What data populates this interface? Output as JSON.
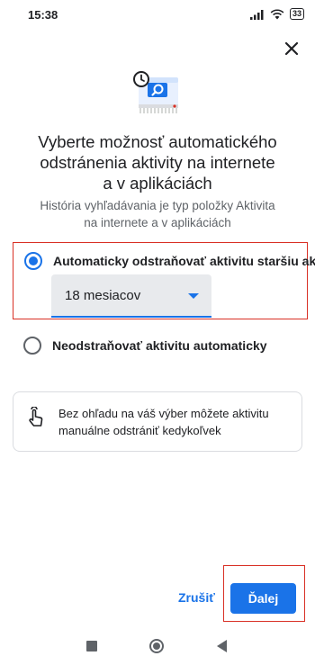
{
  "status_bar": {
    "time": "15:38",
    "signal_icon": "signal-icon",
    "wifi_icon": "wifi-icon",
    "battery_level": "33"
  },
  "dialog": {
    "close_icon": "close-icon",
    "hero_icon": "auto-delete-activity-icon",
    "title_line1": "Vyberte možnosť automatického",
    "title_line2": "odstránenia aktivity na internete",
    "title_line3": "a v aplikáciách",
    "subtitle_line1": "História vyhľadávania je typ položky Aktivita",
    "subtitle_line2": "na internete a v aplikáciách",
    "options": [
      {
        "label": "Automaticky odstraňovať aktivitu staršiu ako",
        "selected": true
      },
      {
        "label": "Neodstraňovať aktivitu automaticky",
        "selected": false
      }
    ],
    "period_select": {
      "value": "18 mesiacov"
    },
    "info_card": {
      "icon": "hand-touch-icon",
      "text_line1": "Bez ohľadu na váš výber môžete aktivitu",
      "text_line2": "manuálne odstrániť kedykoľvek"
    },
    "actions": {
      "cancel_label": "Zrušiť",
      "next_label": "Ďalej"
    }
  },
  "colors": {
    "accent": "#1a73e8",
    "highlight_border": "#d93025",
    "text_primary": "#202124",
    "text_secondary": "#5f6368"
  },
  "nav_bar": {
    "recents_icon": "recents-square-icon",
    "home_icon": "home-circle-icon",
    "back_icon": "back-triangle-icon"
  }
}
